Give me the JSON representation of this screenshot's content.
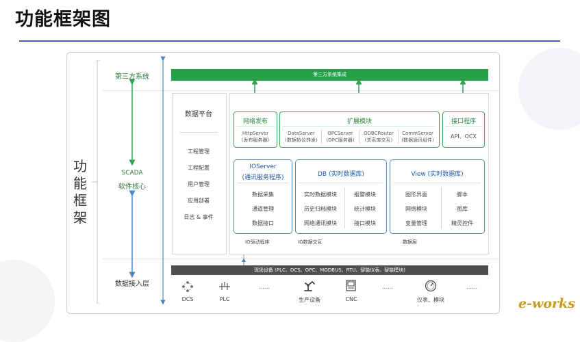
{
  "page_title": "功能框架图",
  "side_title_chars": [
    "功",
    "能",
    "框",
    "架"
  ],
  "left_labels": {
    "third_party": "第三方系统",
    "scada_line1": "SCADA",
    "scada_line2": "软件核心",
    "data_access": "数据接入层"
  },
  "top_bar": "第三方系统集成",
  "data_platform": {
    "title": "数据平台",
    "items": [
      "工程管理",
      "工程配置",
      "用户管理",
      "应用部署",
      "日志 & 事件"
    ]
  },
  "network_publish": {
    "title": "网络发布",
    "sub": [
      "HttpServer",
      "(发布服务器)"
    ]
  },
  "extension": {
    "title": "扩展模块",
    "modules": [
      {
        "name": "DataServer",
        "desc": "(数据协议转发)"
      },
      {
        "name": "OPCServer",
        "desc": "(OPC服务器)"
      },
      {
        "name": "ODBCRouter",
        "desc": "(关系库交互)"
      },
      {
        "name": "CommServer",
        "desc": "(数据通讯组件)"
      }
    ]
  },
  "api": {
    "title": "接口程序",
    "sub": "API、OCX"
  },
  "ioserver": {
    "title_line1": "IOServer",
    "title_line2": "(通讯服务程序)",
    "items": [
      "数据采集",
      "通道管理",
      "数据接口"
    ]
  },
  "db": {
    "title": "DB (实时数据库)",
    "left_items": [
      "实时数据模块",
      "历史归档模块",
      "网络通讯模块"
    ],
    "right_items": [
      "报警模块",
      "统计模块",
      "接口模块"
    ]
  },
  "view": {
    "title": "View (实时数据库)",
    "left_items": [
      "图形界面",
      "网络模块",
      "变量管理"
    ],
    "right_items": [
      "脚本",
      "图库",
      "精灵控件"
    ]
  },
  "bottom_tags": {
    "io_driver": "IO驱动程序",
    "io_exchange": "IO数据交互",
    "data_layer": "数据层"
  },
  "field_bar": "现场设备 (PLC、DCS、OPC、MODBUS、RTU、智能仪表、智能模块)",
  "devices": {
    "dcs": "DCS",
    "plc": "PLC",
    "production": "生产设备",
    "cnc": "CNC",
    "instrument": "仪表、模块",
    "ellipsis": "……"
  },
  "logo_text": "e-works"
}
